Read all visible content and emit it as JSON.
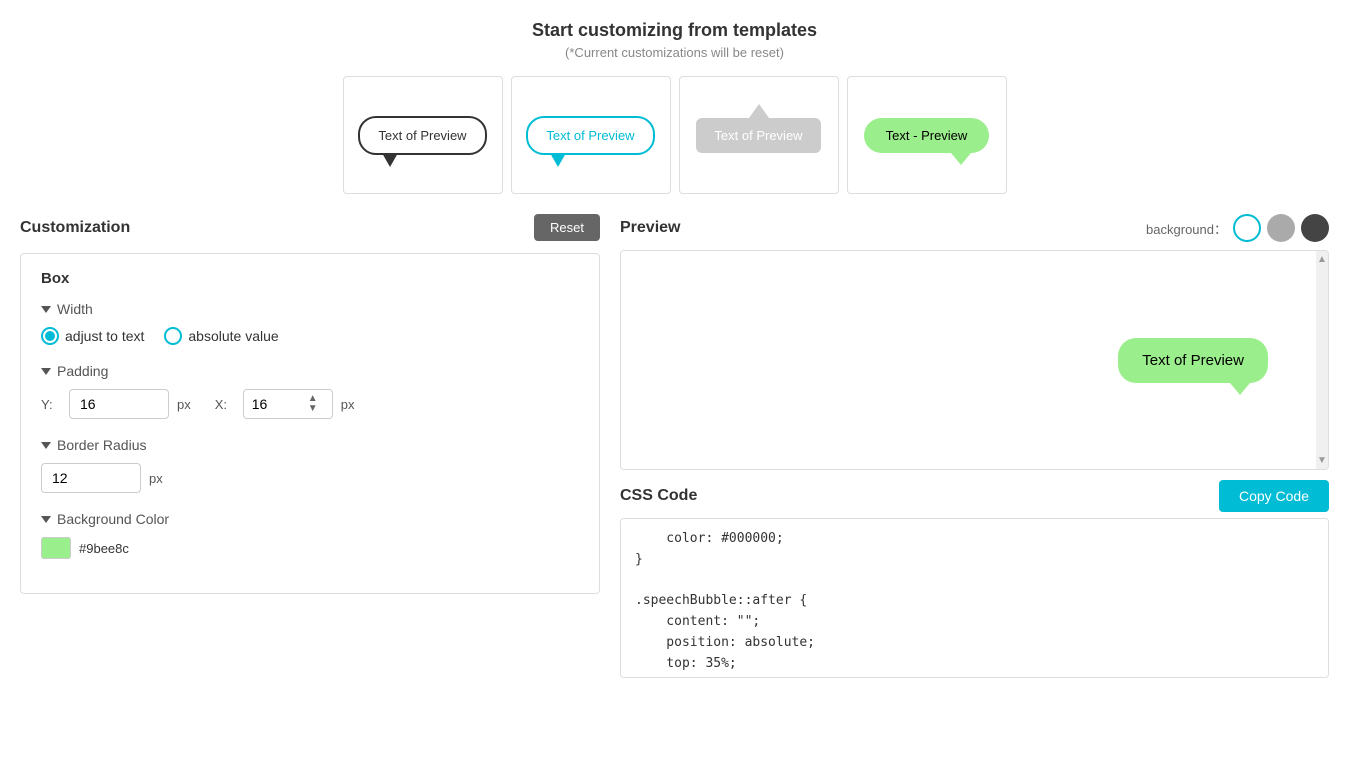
{
  "templates": {
    "title": "Start customizing from templates",
    "subtitle": "(*Current customizations will be reset)",
    "cards": [
      {
        "id": "outline",
        "label": "Text of Preview",
        "style": "outline"
      },
      {
        "id": "teal",
        "label": "Text of Preview",
        "style": "teal"
      },
      {
        "id": "gray-top",
        "label": "Text of Preview",
        "style": "gray-top"
      },
      {
        "id": "green",
        "label": "Text - Preview",
        "style": "green"
      }
    ]
  },
  "customization": {
    "title": "Customization",
    "reset_label": "Reset",
    "box_title": "Box",
    "width": {
      "label": "Width",
      "option1": "adjust to text",
      "option2": "absolute value",
      "selected": "adjust to text"
    },
    "padding": {
      "label": "Padding",
      "y_label": "Y:",
      "x_label": "X:",
      "y_value": "16",
      "x_value": "16",
      "unit": "px"
    },
    "border_radius": {
      "label": "Border Radius",
      "value": "12",
      "unit": "px"
    },
    "background_color": {
      "label": "Background Color",
      "color": "#9bee8c",
      "hex": "#9bee8c"
    }
  },
  "preview": {
    "title": "Preview",
    "bg_label": "background：",
    "bubble_text": "Text of Preview",
    "backgrounds": [
      "white",
      "gray",
      "dark"
    ]
  },
  "css_code": {
    "title": "CSS Code",
    "copy_label": "Copy Code",
    "code": "    color: #000000;\n}\n\n.speechBubble::after {\n    content: \"\";\n    position: absolute;\n    top: 35%;"
  }
}
